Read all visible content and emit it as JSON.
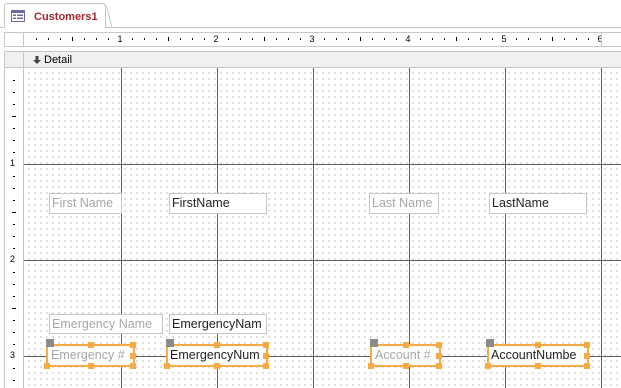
{
  "tab": {
    "title": "Customers1"
  },
  "section": {
    "label": "Detail"
  },
  "ruler": {
    "h_labels": [
      "1",
      "2",
      "3",
      "4",
      "5",
      "6"
    ],
    "v_labels": [
      "1",
      "2",
      "3"
    ]
  },
  "controls": {
    "first_name_label": "First Name",
    "first_name_box": "FirstName",
    "last_name_label": "Last Name",
    "last_name_box": "LastName",
    "emergency_name_label": "Emergency Name",
    "emergency_name_box": "EmergencyNam",
    "emergency_num_label": "Emergency #",
    "emergency_num_box": "EmergencyNum",
    "account_num_label": "Account #",
    "account_num_box": "AccountNumbe"
  },
  "colors": {
    "selection": "#f7a944",
    "tab_title": "#a4262c",
    "label_text": "#a6a6a6"
  }
}
